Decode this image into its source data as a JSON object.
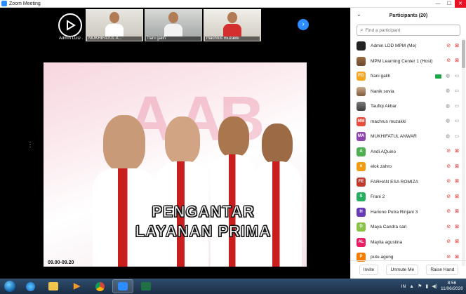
{
  "window": {
    "title": "Zoom Meeting",
    "minimize": "—",
    "maximize": "☐",
    "close": "✕"
  },
  "thumbnails": [
    {
      "name": "Admin LDD ..."
    },
    {
      "name": "MUKHIFATUL A..."
    },
    {
      "name": "frani galih"
    },
    {
      "name": "machrus muzakki"
    }
  ],
  "thumb_next_icon": "›",
  "side_dots": "⋮",
  "share": {
    "bg_text": "A AB",
    "caption_line1": "PENGANTAR",
    "caption_line2": "LAYANAN PRIMA",
    "timestamp": "09.00-09.20"
  },
  "participants_panel": {
    "title": "Participants (20)",
    "collapse_icon": "⌄",
    "search_placeholder": "Find a participant",
    "search_icon": "⌕",
    "participants": [
      {
        "name": "Admin LDD MPM (Me)",
        "initials": "",
        "color": "#222222",
        "mic": "muted",
        "cam": "off"
      },
      {
        "name": "MPM Learning Center 1 (Host)",
        "initials": "",
        "color": "#8a5a35",
        "mic": "muted",
        "cam": "off"
      },
      {
        "name": "frani galih",
        "initials": "FG",
        "color": "#f5a623",
        "mic": "on",
        "cam": "on",
        "sharing": true
      },
      {
        "name": "Nanik sovia",
        "initials": "",
        "color": "#a07b5a",
        "mic": "on",
        "cam": "on"
      },
      {
        "name": "Taufiqi Akbar",
        "initials": "",
        "color": "#555555",
        "mic": "on",
        "cam": "on"
      },
      {
        "name": "machrus muzakki",
        "initials": "MM",
        "color": "#e74c3c",
        "mic": "on",
        "cam": "on"
      },
      {
        "name": "MUKHIFATUL ANWAR",
        "initials": "MA",
        "color": "#8e44ad",
        "mic": "on",
        "cam": "on"
      },
      {
        "name": "Andi AQuino",
        "initials": "A",
        "color": "#4caf50",
        "mic": "muted",
        "cam": "off"
      },
      {
        "name": "elok zahro",
        "initials": "e",
        "color": "#f39c12",
        "mic": "muted",
        "cam": "off"
      },
      {
        "name": "FARHAN ESA ROMIZA",
        "initials": "FE",
        "color": "#c0392b",
        "mic": "muted",
        "cam": "off"
      },
      {
        "name": "Frani 2",
        "initials": "S",
        "color": "#27ae60",
        "mic": "muted",
        "cam": "off"
      },
      {
        "name": "Hariono Putra Rinjani 3",
        "initials": "H",
        "color": "#673ab7",
        "mic": "muted",
        "cam": "off"
      },
      {
        "name": "Maya Candra sari",
        "initials": "D",
        "color": "#8bc34a",
        "mic": "muted",
        "cam": "off"
      },
      {
        "name": "Maylia agustina",
        "initials": "AL",
        "color": "#e91e63",
        "mic": "muted",
        "cam": "off"
      },
      {
        "name": "putu.agung",
        "initials": "P",
        "color": "#f57c00",
        "mic": "muted",
        "cam": "off"
      }
    ],
    "footer": {
      "invite": "Invite",
      "unmute_me": "Unmute Me",
      "raise_hand": "Raise Hand"
    }
  },
  "taskbar": {
    "lang": "IN",
    "time": "8:56",
    "date": "11/06/2020",
    "tray_icons": [
      "▲",
      "⚑",
      "▮",
      "◀)"
    ]
  }
}
